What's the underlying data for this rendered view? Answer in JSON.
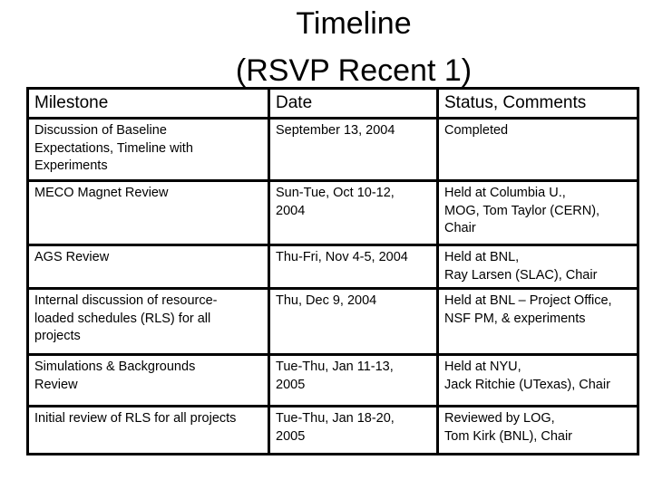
{
  "title": {
    "line1": "Timeline",
    "line2": "(RSVP Recent 1)"
  },
  "table": {
    "headers": [
      "Milestone",
      "Date",
      "Status, Comments"
    ],
    "rows": [
      {
        "milestone": "Discussion of Baseline\nExpectations, Timeline with\nExperiments",
        "date": "September 13, 2004",
        "status": "Completed"
      },
      {
        "milestone": "MECO Magnet Review",
        "date": "Sun-Tue, Oct 10-12,\n2004",
        "status": "Held at Columbia U.,\nMOG, Tom Taylor (CERN),\nChair"
      },
      {
        "milestone": "AGS Review",
        "date": "Thu-Fri, Nov 4-5, 2004",
        "status": "Held at BNL,\nRay Larsen (SLAC), Chair"
      },
      {
        "milestone": "Internal discussion of resource-\nloaded schedules (RLS) for all\nprojects",
        "date": "Thu, Dec 9, 2004",
        "status": "Held at BNL – Project Office,\nNSF PM, & experiments"
      },
      {
        "milestone": "Simulations & Backgrounds\nReview",
        "date": "Tue-Thu, Jan 11-13,\n2005",
        "status": "Held at NYU,\nJack Ritchie (UTexas), Chair"
      },
      {
        "milestone": "Initial review of RLS for all projects",
        "date": "Tue-Thu, Jan 18-20,\n2005",
        "status": "Reviewed by LOG,\nTom Kirk (BNL), Chair"
      }
    ]
  }
}
